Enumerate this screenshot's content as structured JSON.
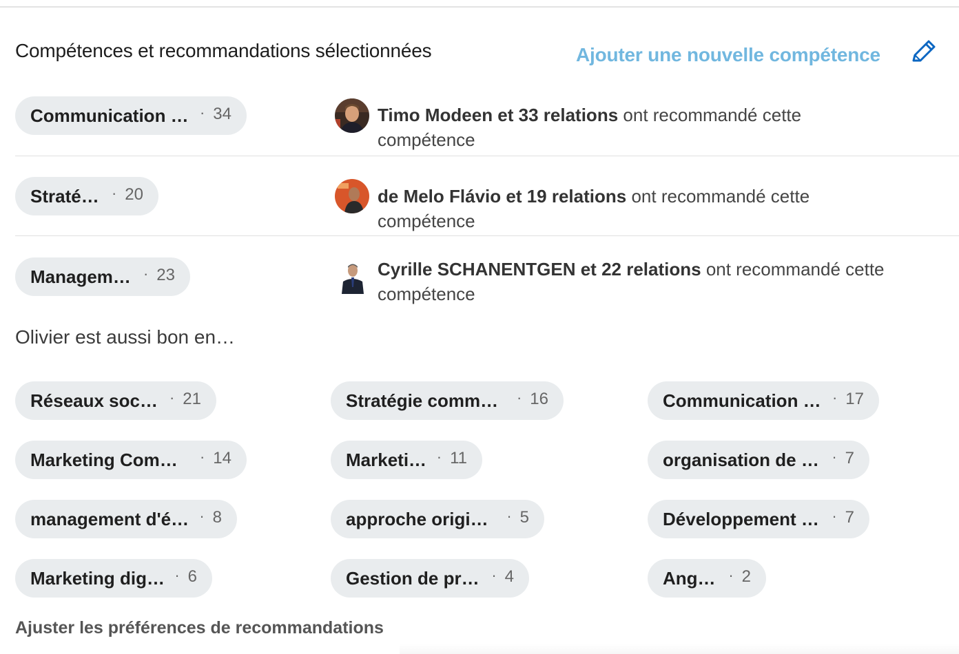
{
  "header": {
    "title": "Compétences et recommandations sélectionnées",
    "add_skill_label": "Ajouter une nouvelle compétence",
    "edit_icon": "pencil-icon"
  },
  "featured": [
    {
      "skill": "Communication m..",
      "count": "34",
      "endorser": "Timo Modeen et 33 relations",
      "suffix": "ont recommandé cette compétence"
    },
    {
      "skill": "Stratégie",
      "count": "20",
      "endorser": "de Melo Flávio et 19 relations",
      "suffix": "ont recommandé cette compétence"
    },
    {
      "skill": "Management",
      "count": "23",
      "endorser": "Cyrille SCHANENTGEN et 22 relations",
      "suffix": "ont recommandé cette compétence"
    }
  ],
  "also_good": {
    "heading": "Olivier est aussi bon en…",
    "skills": [
      {
        "name": "Réseaux sociaux",
        "count": "21"
      },
      {
        "name": "Stratégie commer…",
        "count": "16"
      },
      {
        "name": "Communication d…",
        "count": "17"
      },
      {
        "name": "Marketing Commu…",
        "count": "14"
      },
      {
        "name": "Marketing",
        "count": "11"
      },
      {
        "name": "organisation de pr…",
        "count": "7"
      },
      {
        "name": "management d'éq…",
        "count": "8"
      },
      {
        "name": "approche originale",
        "count": "5"
      },
      {
        "name": "Développement c…",
        "count": "7"
      },
      {
        "name": "Marketing digital",
        "count": "6"
      },
      {
        "name": "Gestion de projet",
        "count": "4"
      },
      {
        "name": "Anglais",
        "count": "2"
      }
    ]
  },
  "footer": {
    "adjust_label": "Ajuster les préférences de recommandations"
  },
  "colors": {
    "accent": "#71b7df",
    "pencil": "#0a66c2",
    "pill_bg": "#e9ecee"
  }
}
